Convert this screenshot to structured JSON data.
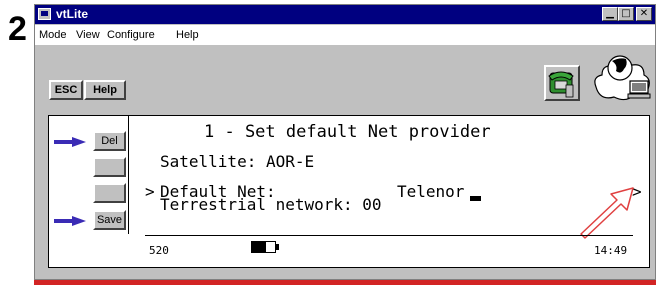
{
  "step_number": "2",
  "window": {
    "title": "vtLite"
  },
  "menu": [
    "Mode",
    "View",
    "Configure",
    "Help"
  ],
  "toolbar": {
    "esc_label": "ESC",
    "help_label": "Help"
  },
  "side_buttons": {
    "del_label": "Del",
    "blank1_label": "",
    "blank2_label": "",
    "save_label": "Save"
  },
  "screen": {
    "title": "1 - Set default Net provider",
    "satellite_line": "Satellite: AOR-E",
    "cursor_marker": ">",
    "default_net_label": "Default Net:",
    "default_net_value": "Telenor",
    "terrestrial_line": "Terrestrial network: 00",
    "next_marker": ">"
  },
  "status": {
    "left_value": "520",
    "time": "14:49"
  },
  "colors": {
    "titlebar": "#000080",
    "arrow": "#3a2bb5",
    "hint_arrow": "#e04040",
    "stripe": "#d22424"
  }
}
